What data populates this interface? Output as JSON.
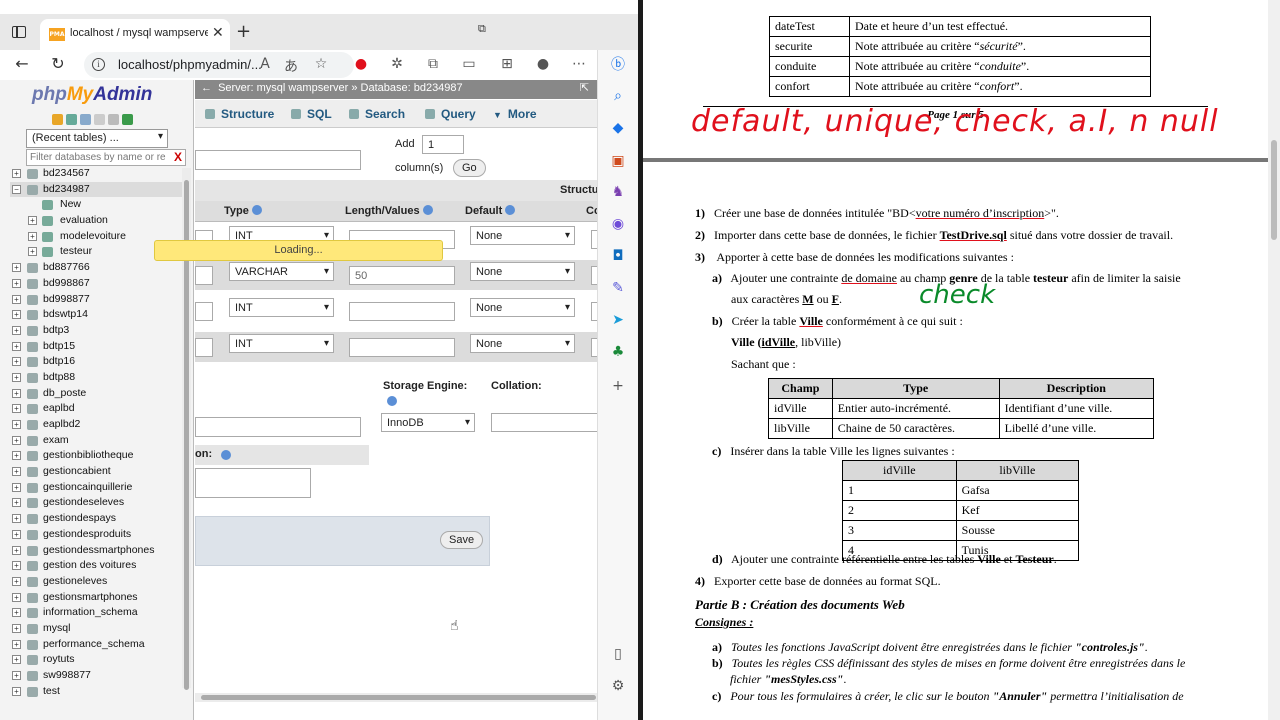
{
  "browser": {
    "tab_title": "localhost / mysql wampserver / b",
    "tab_favicon": "PMA",
    "url": "localhost/phpmyadmin/...",
    "toolbar_icons": [
      "read-aloud-icon",
      "translate-icon",
      "favorite-icon",
      "opera-icon",
      "extension-icon",
      "puzzle-icon",
      "collections-icon",
      "profile-icon",
      "more-icon"
    ],
    "sidebar_icons": [
      "bing-icon",
      "search-icon",
      "tag-icon",
      "briefcase-icon",
      "chess-icon",
      "circle-icon",
      "outlook-icon",
      "edit-icon",
      "send-icon",
      "tree-icon",
      "plus-icon",
      "split-icon",
      "settings-icon"
    ]
  },
  "pma": {
    "logo": {
      "php": "php",
      "my": "My",
      "admin": "Admin"
    },
    "recent_tables": "(Recent tables) ...",
    "db_filter_placeholder": "Filter databases by name or re",
    "tree": [
      {
        "label": "bd234567",
        "level": 0,
        "expanded": false
      },
      {
        "label": "bd234987",
        "level": 0,
        "expanded": true,
        "selected": true
      },
      {
        "label": "New",
        "level": 1,
        "expanded": null
      },
      {
        "label": "evaluation",
        "level": 1,
        "expanded": false
      },
      {
        "label": "modelevoiture",
        "level": 1,
        "expanded": false
      },
      {
        "label": "testeur",
        "level": 1,
        "expanded": false
      },
      {
        "label": "bd887766",
        "level": 0,
        "expanded": false
      },
      {
        "label": "bd998867",
        "level": 0,
        "expanded": false
      },
      {
        "label": "bd998877",
        "level": 0,
        "expanded": false
      },
      {
        "label": "bdswtp14",
        "level": 0,
        "expanded": false
      },
      {
        "label": "bdtp3",
        "level": 0,
        "expanded": false
      },
      {
        "label": "bdtp15",
        "level": 0,
        "expanded": false
      },
      {
        "label": "bdtp16",
        "level": 0,
        "expanded": false
      },
      {
        "label": "bdtp88",
        "level": 0,
        "expanded": false
      },
      {
        "label": "db_poste",
        "level": 0,
        "expanded": false
      },
      {
        "label": "eaplbd",
        "level": 0,
        "expanded": false
      },
      {
        "label": "eaplbd2",
        "level": 0,
        "expanded": false
      },
      {
        "label": "exam",
        "level": 0,
        "expanded": false
      },
      {
        "label": "gestionbibliotheque",
        "level": 0,
        "expanded": false
      },
      {
        "label": "gestioncabient",
        "level": 0,
        "expanded": false
      },
      {
        "label": "gestioncainquillerie",
        "level": 0,
        "expanded": false
      },
      {
        "label": "gestiondeseleves",
        "level": 0,
        "expanded": false
      },
      {
        "label": "gestiondespays",
        "level": 0,
        "expanded": false
      },
      {
        "label": "gestiondesproduits",
        "level": 0,
        "expanded": false
      },
      {
        "label": "gestiondessmartphones",
        "level": 0,
        "expanded": false
      },
      {
        "label": "gestion des voitures",
        "level": 0,
        "expanded": false
      },
      {
        "label": "gestioneleves",
        "level": 0,
        "expanded": false
      },
      {
        "label": "gestionsmartphones",
        "level": 0,
        "expanded": false
      },
      {
        "label": "information_schema",
        "level": 0,
        "expanded": false
      },
      {
        "label": "mysql",
        "level": 0,
        "expanded": false
      },
      {
        "label": "performance_schema",
        "level": 0,
        "expanded": false
      },
      {
        "label": "roytuts",
        "level": 0,
        "expanded": false
      },
      {
        "label": "sw998877",
        "level": 0,
        "expanded": false
      },
      {
        "label": "test",
        "level": 0,
        "expanded": false
      }
    ],
    "breadcrumb": {
      "server": "Server: mysql wampserver",
      "sep": "»",
      "database": "Database: bd234987"
    },
    "tabs": [
      "Structure",
      "SQL",
      "Search",
      "Query",
      "More"
    ],
    "add_label": "Add",
    "add_value": "1",
    "columns_label": "column(s)",
    "go_label": "Go",
    "structure_label": "Structu",
    "headers": {
      "type": "Type",
      "length": "Length/Values",
      "default": "Default",
      "collation": "Co"
    },
    "rows": [
      {
        "type": "INT",
        "length": "",
        "default": "None"
      },
      {
        "type": "VARCHAR",
        "length": "50",
        "default": "None"
      },
      {
        "type": "INT",
        "length": "",
        "default": "None"
      },
      {
        "type": "INT",
        "length": "",
        "default": "None"
      }
    ],
    "loading": "Loading...",
    "storage_engine_label": "Storage Engine:",
    "storage_engine_value": "InnoDB",
    "collation_label": "Collation:",
    "partition_label": "on:",
    "save_label": "Save"
  },
  "document": {
    "top_table": [
      {
        "champ": "dateTest",
        "desc_plain": "Date et heure d’un test effectué.",
        "desc_italic": ""
      },
      {
        "champ": "securite",
        "desc_plain": "Note attribuée au critère “",
        "desc_italic": "sécurité",
        "desc_end": "”."
      },
      {
        "champ": "conduite",
        "desc_plain": "Note attribuée au critère “",
        "desc_italic": "conduite",
        "desc_end": "”."
      },
      {
        "champ": "confort",
        "desc_plain": "Note attribuée au critère “",
        "desc_italic": "confort",
        "desc_end": "”."
      }
    ],
    "page_footer": "Page 1 sur 5",
    "handwriting_red": "default, unique, check, a.I, n null",
    "handwriting_green": "check",
    "items": {
      "q1_num": "1)",
      "q1_a": "Créer une base de données intitulée \"BD<",
      "q1_b": "votre numéro d’inscription",
      "q1_c": ">\".",
      "q2_num": "2)",
      "q2_a": "Importer dans cette base de données, le fichier ",
      "q2_b": "TestDrive.sql",
      "q2_c": " situé dans votre dossier de travail.",
      "q3_num": "3)",
      "q3": "Apporter à cette base de données les modifications suivantes :",
      "a_num": "a)",
      "a_1": "Ajouter une contrainte ",
      "a_2": "de domaine",
      "a_3": " au champ ",
      "a_4": "genre",
      "a_5": " de la table ",
      "a_6": "testeur",
      "a_7": " afin de limiter la saisie",
      "a_line2a": "aux caractères ",
      "a_line2b": "M",
      "a_line2c": " ou ",
      "a_line2d": "F",
      "a_line2e": ".",
      "b_num": "b)",
      "b_1": "Créer la table ",
      "b_2": "Ville",
      "b_3": " conformément à ce qui suit :",
      "b_schema_a": "Ville (",
      "b_schema_b": "idVille",
      "b_schema_c": ", libVille)",
      "b_sachant": "Sachant que :",
      "c_num": "c)",
      "c_text": "Insérer dans la table Ville les lignes suivantes :",
      "d_num": "d)",
      "d_1": "Ajouter une contrainte référentielle entre les tables ",
      "d_2": "Ville",
      "d_3": " et ",
      "d_4": "Testeur",
      "d_5": ".",
      "q4_num": "4)",
      "q4": "Exporter cette base de données au format SQL.",
      "partB": "Partie B : Création des documents Web",
      "consignes": "Consignes :",
      "ca_num": "a)",
      "ca_1": "Toutes les fonctions JavaScript doivent être enregistrées dans le fichier ",
      "ca_2": "\"controles.js\"",
      "ca_3": ".",
      "cb_num": "b)",
      "cb_1": "Toutes les règles CSS définissant des styles de mises en forme doivent être enregistrées dans le",
      "cb_2": "fichier ",
      "cb_3": "\"mesStyles.css\"",
      "cb_4": ".",
      "cc_num": "c)",
      "cc_1": "Pour tous les formulaires à créer, le clic sur le bouton ",
      "cc_2": "\"Annuler\"",
      "cc_3": " permettra l’initialisation de"
    },
    "ville_table": {
      "headers": [
        "Champ",
        "Type",
        "Description"
      ],
      "rows": [
        [
          "idVille",
          "Entier auto-incrémenté.",
          "Identifiant d’une ville."
        ],
        [
          "libVille",
          "Chaine de 50 caractères.",
          "Libellé d’une ville."
        ]
      ]
    },
    "lignes_table": {
      "headers": [
        "idVille",
        "libVille"
      ],
      "rows": [
        [
          "1",
          "Gafsa"
        ],
        [
          "2",
          "Kef"
        ],
        [
          "3",
          "Sousse"
        ],
        [
          "4",
          "Tunis"
        ]
      ]
    }
  }
}
